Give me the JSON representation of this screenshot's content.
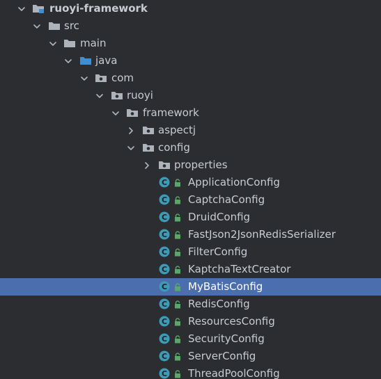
{
  "project": {
    "name": "ruoyi-framework",
    "icon": "module-folder-icon"
  },
  "tree": {
    "folders": {
      "src": "src",
      "main": "main",
      "java": "java",
      "com": "com",
      "ruoyi": "ruoyi",
      "framework": "framework",
      "aspectj": "aspectj",
      "config": "config",
      "properties": "properties"
    },
    "classes": [
      "ApplicationConfig",
      "CaptchaConfig",
      "DruidConfig",
      "FastJson2JsonRedisSerializer",
      "FilterConfig",
      "KaptchaTextCreator",
      "MyBatisConfig",
      "RedisConfig",
      "ResourcesConfig",
      "SecurityConfig",
      "ServerConfig",
      "ThreadPoolConfig"
    ],
    "selected": "MyBatisConfig"
  },
  "colors": {
    "background": "#2b2d30",
    "selection": "#4b6eaf",
    "text": "#c8ccd2",
    "folder": "#aeb3bb",
    "source_folder": "#3d8fd4",
    "class_icon": "#3d9bb8",
    "lock": "#59a869"
  },
  "icons": {
    "expanded": "chevron-down-icon",
    "collapsed": "chevron-right-icon",
    "folder": "folder-icon",
    "package": "package-icon",
    "class": "class-icon",
    "lock": "lock-icon"
  }
}
